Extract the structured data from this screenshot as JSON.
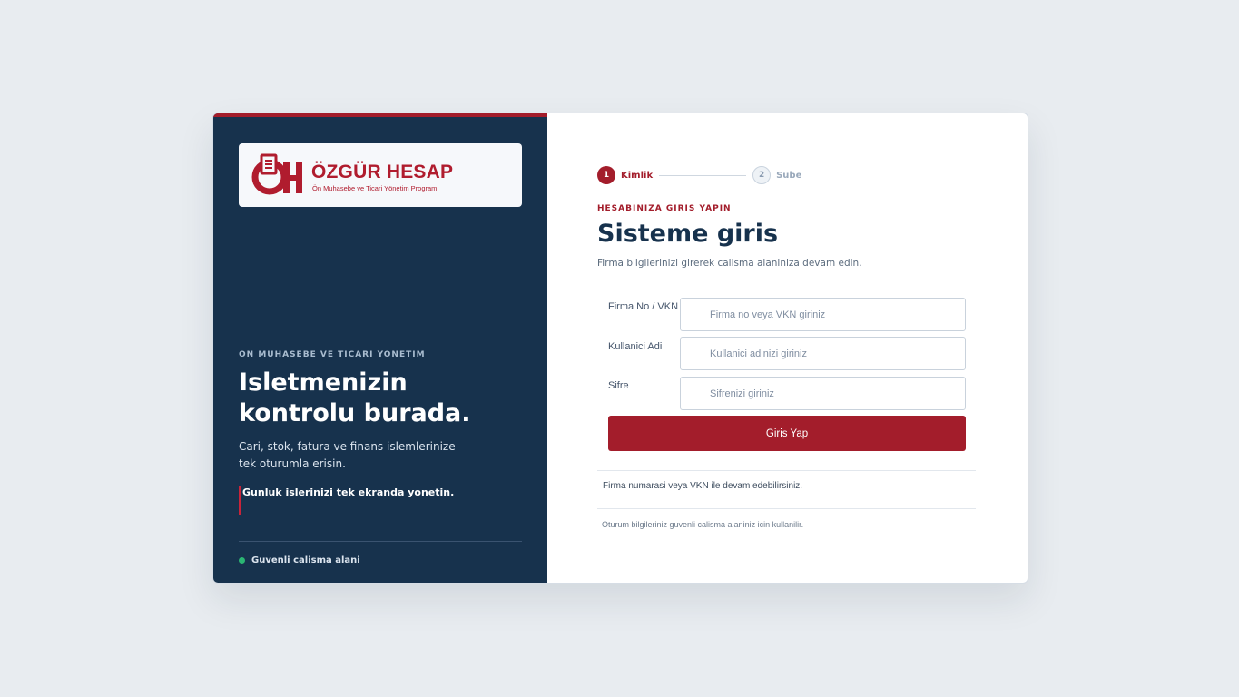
{
  "brand": {
    "name": "ÖZGÜR HESAP",
    "tagline": "Ön Muhasebe ve Ticari Yönetim Programı",
    "logo_icon": "oh-document-logo-icon",
    "primary_color": "#a31d2b",
    "navy_color": "#17324d"
  },
  "left_panel": {
    "eyebrow": "ON MUHASEBE VE TICARI YONETIM",
    "headline": "Isletmenizin kontrolu burada.",
    "description": "Cari, stok, fatura ve finans islemlerinize tek oturumla erisin.",
    "quote": "Gunluk islerinizi tek ekranda yonetin.",
    "status_text": "Guvenli calisma alani",
    "status_color": "#2bb673"
  },
  "steps": [
    {
      "number": "1",
      "label": "Kimlik",
      "active": true
    },
    {
      "number": "2",
      "label": "Sube",
      "active": false
    }
  ],
  "form": {
    "eyebrow": "HESABINIZA GIRIS YAPIN",
    "title": "Sisteme giris",
    "subtitle": "Firma bilgilerinizi girerek calisma alaniniza devam edin.",
    "fields": [
      {
        "label": "Firma No / VKN",
        "placeholder": "Firma no veya VKN giriniz",
        "value": ""
      },
      {
        "label": "Kullanici Adi",
        "placeholder": "Kullanici adinizi giriniz",
        "value": ""
      },
      {
        "label": "Sifre",
        "placeholder": "Sifrenizi giriniz",
        "value": ""
      }
    ],
    "submit_label": "Giris Yap",
    "note_primary": "Firma numarasi veya VKN ile devam edebilirsiniz.",
    "note_secondary": "Oturum bilgileriniz guvenli calisma alaniniz icin kullanilir."
  }
}
